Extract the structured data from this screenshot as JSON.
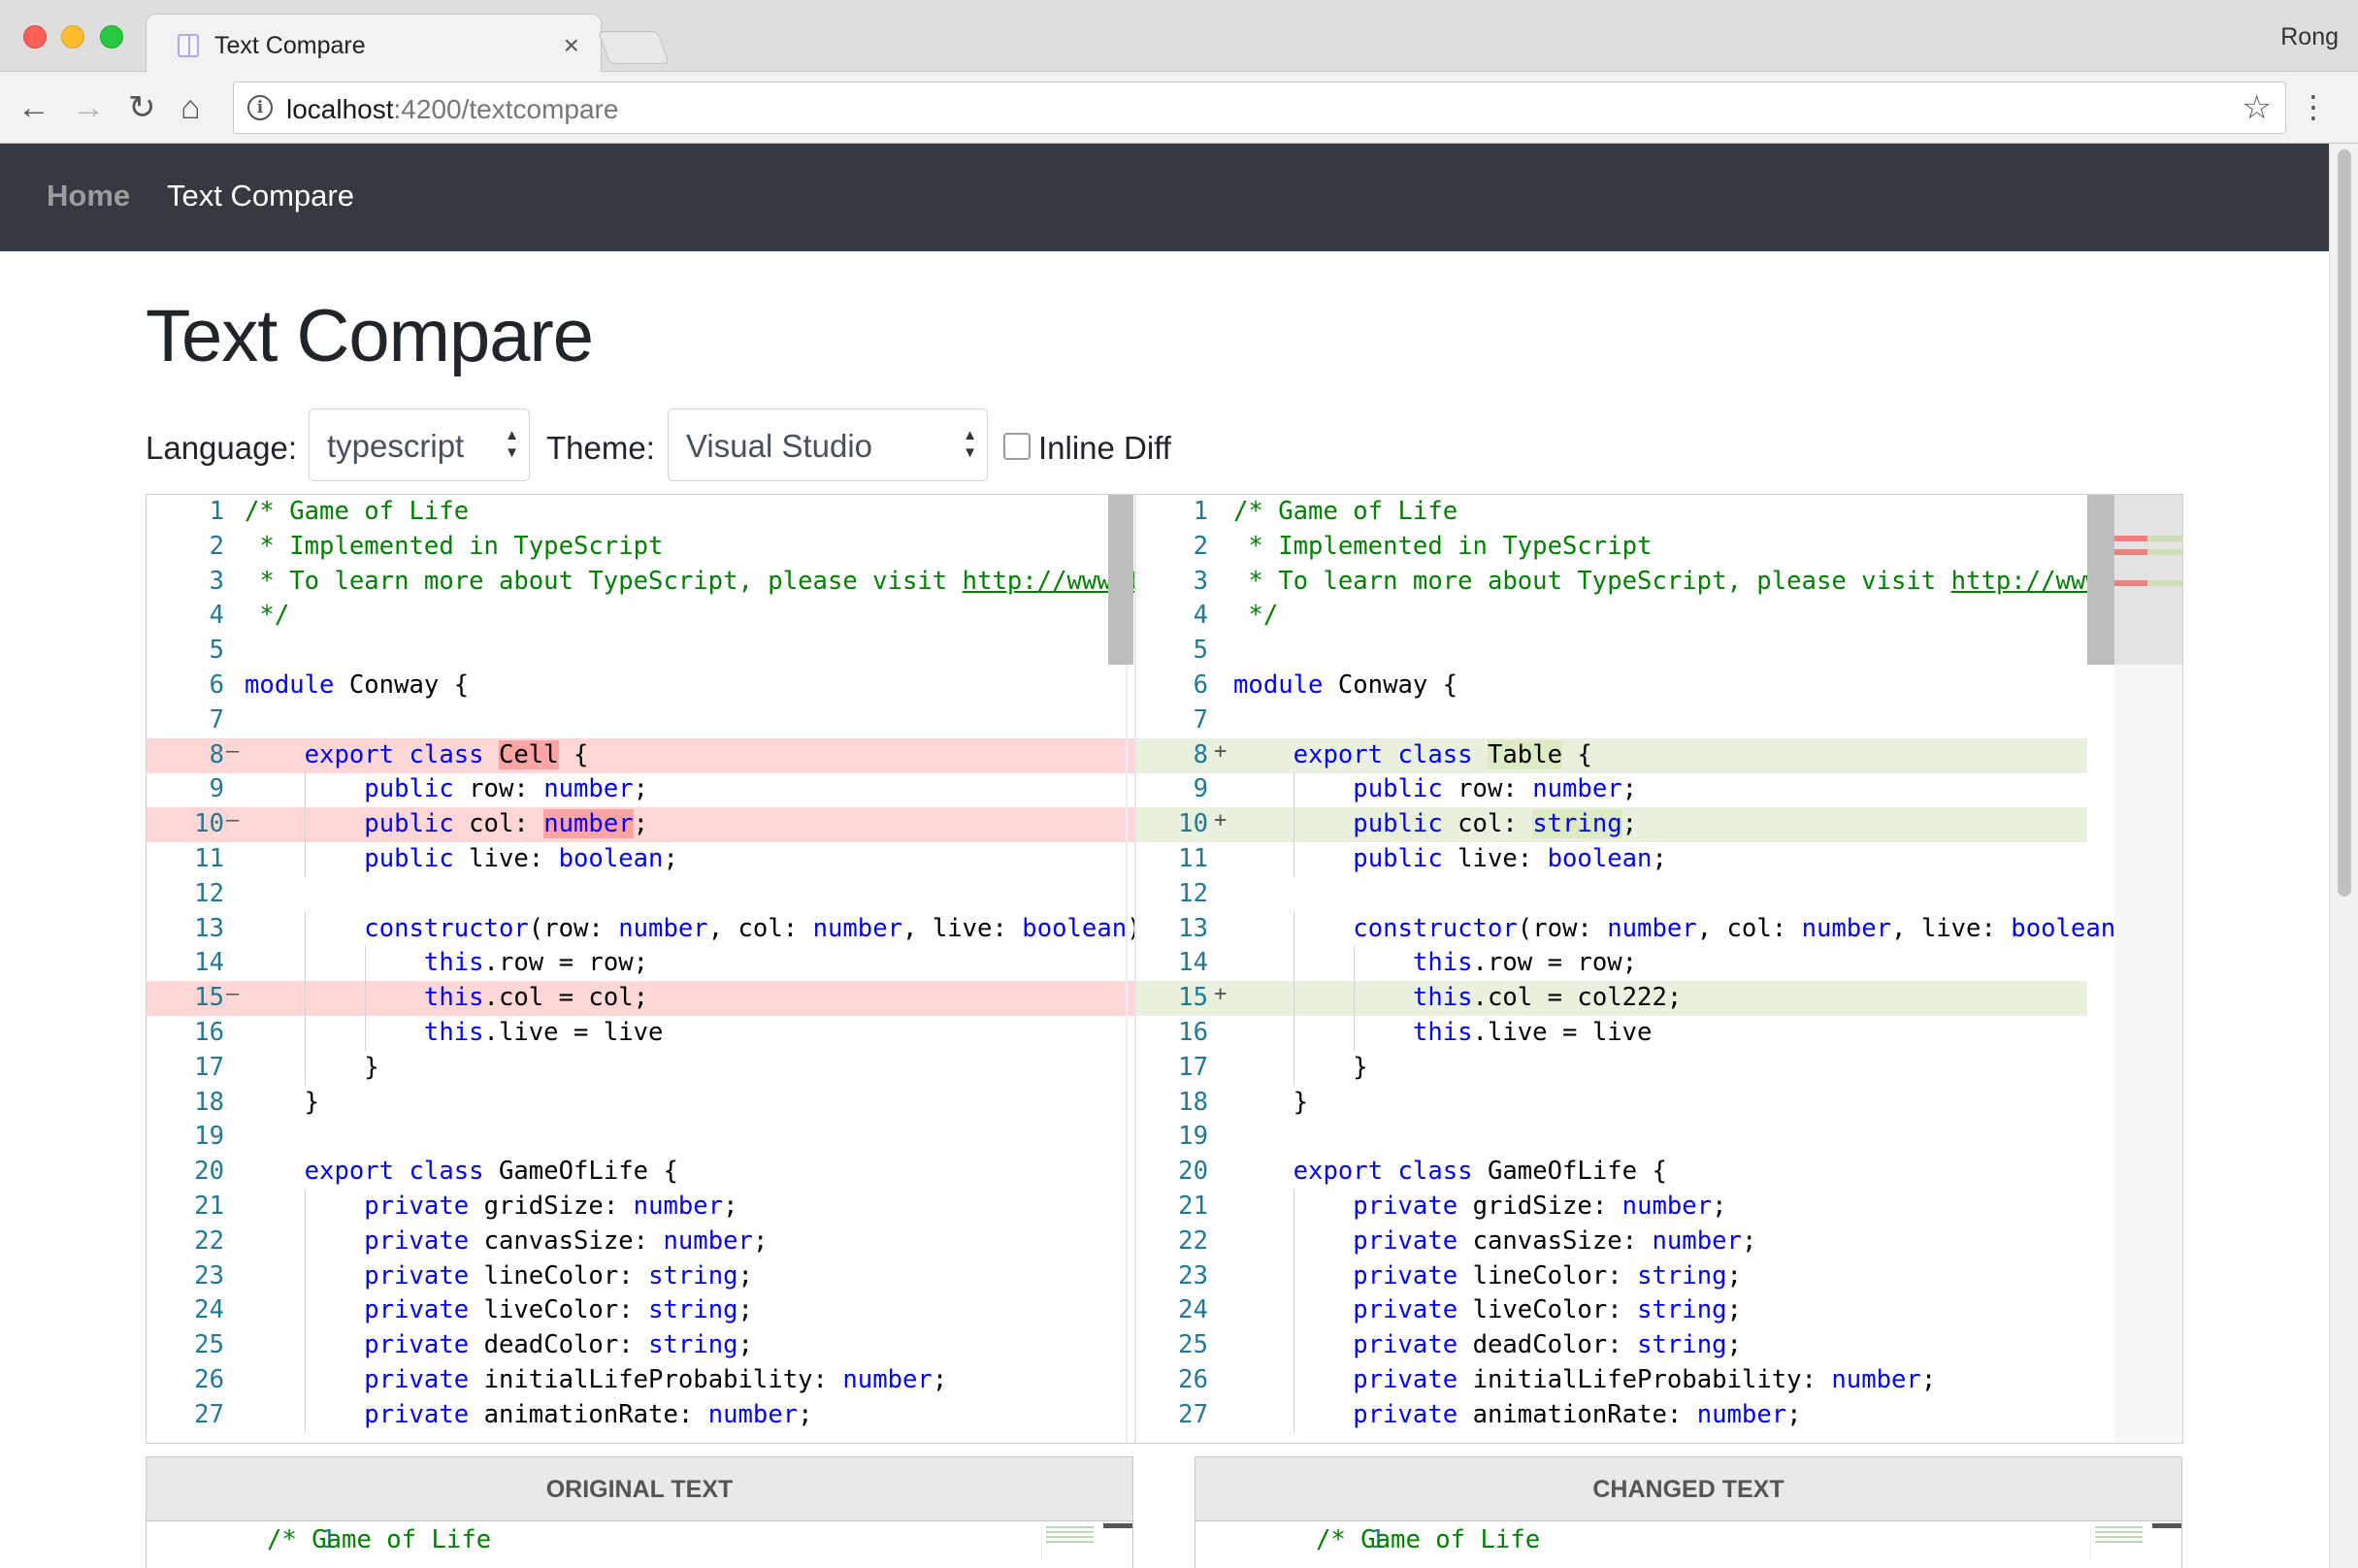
{
  "browser": {
    "tab_title": "Text Compare",
    "profile_name": "Rong",
    "url_host": "localhost",
    "url_rest": ":4200/textcompare"
  },
  "navbar": {
    "brand": "Home",
    "active": "Text Compare"
  },
  "page": {
    "title": "Text Compare",
    "language_label": "Language:",
    "language_value": "typescript",
    "theme_label": "Theme:",
    "theme_value": "Visual Studio",
    "inline_diff_label": "Inline Diff",
    "inline_diff_checked": false
  },
  "diff": {
    "original": [
      {
        "n": "1",
        "t": "",
        "code": [
          [
            "cm",
            "/* Game of Life"
          ]
        ]
      },
      {
        "n": "2",
        "t": "",
        "code": [
          [
            "cm",
            " * Implemented in TypeScript"
          ]
        ]
      },
      {
        "n": "3",
        "t": "",
        "code": [
          [
            "cm",
            " * To learn more about TypeScript, please visit "
          ],
          [
            "cm ul",
            "http://www.types"
          ]
        ]
      },
      {
        "n": "4",
        "t": "",
        "code": [
          [
            "cm",
            " */"
          ]
        ]
      },
      {
        "n": "5",
        "t": "",
        "code": []
      },
      {
        "n": "6",
        "t": "",
        "code": [
          [
            "kw",
            "module"
          ],
          [
            "",
            " Conway {"
          ]
        ]
      },
      {
        "n": "7",
        "t": "",
        "code": []
      },
      {
        "n": "8",
        "t": "del",
        "code": [
          [
            "",
            "    "
          ],
          [
            "kw",
            "export"
          ],
          [
            "",
            " "
          ],
          [
            "kw",
            "class"
          ],
          [
            "",
            " "
          ],
          [
            "hl-del",
            "Cell"
          ],
          [
            "",
            " {"
          ]
        ]
      },
      {
        "n": "9",
        "t": "",
        "code": [
          [
            "",
            "        "
          ],
          [
            "kw",
            "public"
          ],
          [
            "",
            " row: "
          ],
          [
            "kw",
            "number"
          ],
          [
            "",
            ";"
          ]
        ]
      },
      {
        "n": "10",
        "t": "del",
        "code": [
          [
            "",
            "        "
          ],
          [
            "kw",
            "public"
          ],
          [
            "",
            " col: "
          ],
          [
            "kw hl-del",
            "number"
          ],
          [
            "",
            ";"
          ]
        ]
      },
      {
        "n": "11",
        "t": "",
        "code": [
          [
            "",
            "        "
          ],
          [
            "kw",
            "public"
          ],
          [
            "",
            " live: "
          ],
          [
            "kw",
            "boolean"
          ],
          [
            "",
            ";"
          ]
        ]
      },
      {
        "n": "12",
        "t": "",
        "code": []
      },
      {
        "n": "13",
        "t": "",
        "code": [
          [
            "",
            "        "
          ],
          [
            "kw",
            "constructor"
          ],
          [
            "",
            "(row: "
          ],
          [
            "kw",
            "number"
          ],
          [
            "",
            ", col: "
          ],
          [
            "kw",
            "number"
          ],
          [
            "",
            ", live: "
          ],
          [
            "kw",
            "boolean"
          ],
          [
            "",
            ") {"
          ]
        ]
      },
      {
        "n": "14",
        "t": "",
        "code": [
          [
            "",
            "            "
          ],
          [
            "kw",
            "this"
          ],
          [
            "",
            ".row = row;"
          ]
        ]
      },
      {
        "n": "15",
        "t": "del",
        "code": [
          [
            "",
            "            "
          ],
          [
            "kw",
            "this"
          ],
          [
            "",
            ".col = col;"
          ]
        ]
      },
      {
        "n": "16",
        "t": "",
        "code": [
          [
            "",
            "            "
          ],
          [
            "kw",
            "this"
          ],
          [
            "",
            ".live = live"
          ]
        ]
      },
      {
        "n": "17",
        "t": "",
        "code": [
          [
            "",
            "        }"
          ]
        ]
      },
      {
        "n": "18",
        "t": "",
        "code": [
          [
            "",
            "    }"
          ]
        ]
      },
      {
        "n": "19",
        "t": "",
        "code": []
      },
      {
        "n": "20",
        "t": "",
        "code": [
          [
            "",
            "    "
          ],
          [
            "kw",
            "export"
          ],
          [
            "",
            " "
          ],
          [
            "kw",
            "class"
          ],
          [
            "",
            " GameOfLife {"
          ]
        ]
      },
      {
        "n": "21",
        "t": "",
        "code": [
          [
            "",
            "        "
          ],
          [
            "kw",
            "private"
          ],
          [
            "",
            " gridSize: "
          ],
          [
            "kw",
            "number"
          ],
          [
            "",
            ";"
          ]
        ]
      },
      {
        "n": "22",
        "t": "",
        "code": [
          [
            "",
            "        "
          ],
          [
            "kw",
            "private"
          ],
          [
            "",
            " canvasSize: "
          ],
          [
            "kw",
            "number"
          ],
          [
            "",
            ";"
          ]
        ]
      },
      {
        "n": "23",
        "t": "",
        "code": [
          [
            "",
            "        "
          ],
          [
            "kw",
            "private"
          ],
          [
            "",
            " lineColor: "
          ],
          [
            "kw",
            "string"
          ],
          [
            "",
            ";"
          ]
        ]
      },
      {
        "n": "24",
        "t": "",
        "code": [
          [
            "",
            "        "
          ],
          [
            "kw",
            "private"
          ],
          [
            "",
            " liveColor: "
          ],
          [
            "kw",
            "string"
          ],
          [
            "",
            ";"
          ]
        ]
      },
      {
        "n": "25",
        "t": "",
        "code": [
          [
            "",
            "        "
          ],
          [
            "kw",
            "private"
          ],
          [
            "",
            " deadColor: "
          ],
          [
            "kw",
            "string"
          ],
          [
            "",
            ";"
          ]
        ]
      },
      {
        "n": "26",
        "t": "",
        "code": [
          [
            "",
            "        "
          ],
          [
            "kw",
            "private"
          ],
          [
            "",
            " initialLifeProbability: "
          ],
          [
            "kw",
            "number"
          ],
          [
            "",
            ";"
          ]
        ]
      },
      {
        "n": "27",
        "t": "",
        "code": [
          [
            "",
            "        "
          ],
          [
            "kw",
            "private"
          ],
          [
            "",
            " animationRate: "
          ],
          [
            "kw",
            "number"
          ],
          [
            "",
            ";"
          ]
        ]
      }
    ],
    "modified": [
      {
        "n": "1",
        "t": "",
        "code": [
          [
            "cm",
            "/* Game of Life"
          ]
        ]
      },
      {
        "n": "2",
        "t": "",
        "code": [
          [
            "cm",
            " * Implemented in TypeScript"
          ]
        ]
      },
      {
        "n": "3",
        "t": "",
        "code": [
          [
            "cm",
            " * To learn more about TypeScript, please visit "
          ],
          [
            "cm ul",
            "http://www.types"
          ]
        ]
      },
      {
        "n": "4",
        "t": "",
        "code": [
          [
            "cm",
            " */"
          ]
        ]
      },
      {
        "n": "5",
        "t": "",
        "code": []
      },
      {
        "n": "6",
        "t": "",
        "code": [
          [
            "kw",
            "module"
          ],
          [
            "",
            " Conway {"
          ]
        ]
      },
      {
        "n": "7",
        "t": "",
        "code": []
      },
      {
        "n": "8",
        "t": "ins",
        "code": [
          [
            "",
            "    "
          ],
          [
            "kw",
            "export"
          ],
          [
            "",
            " "
          ],
          [
            "kw",
            "class"
          ],
          [
            "",
            " "
          ],
          [
            "hl-ins",
            "Table"
          ],
          [
            "",
            " {"
          ]
        ]
      },
      {
        "n": "9",
        "t": "",
        "code": [
          [
            "",
            "        "
          ],
          [
            "kw",
            "public"
          ],
          [
            "",
            " row: "
          ],
          [
            "kw",
            "number"
          ],
          [
            "",
            ";"
          ]
        ]
      },
      {
        "n": "10",
        "t": "ins",
        "code": [
          [
            "",
            "        "
          ],
          [
            "kw",
            "public"
          ],
          [
            "",
            " col: "
          ],
          [
            "kw hl-ins",
            "string"
          ],
          [
            "",
            ";"
          ]
        ]
      },
      {
        "n": "11",
        "t": "",
        "code": [
          [
            "",
            "        "
          ],
          [
            "kw",
            "public"
          ],
          [
            "",
            " live: "
          ],
          [
            "kw",
            "boolean"
          ],
          [
            "",
            ";"
          ]
        ]
      },
      {
        "n": "12",
        "t": "",
        "code": []
      },
      {
        "n": "13",
        "t": "",
        "code": [
          [
            "",
            "        "
          ],
          [
            "kw",
            "constructor"
          ],
          [
            "",
            "(row: "
          ],
          [
            "kw",
            "number"
          ],
          [
            "",
            ", col: "
          ],
          [
            "kw",
            "number"
          ],
          [
            "",
            ", live: "
          ],
          [
            "kw",
            "boolean"
          ],
          [
            "",
            ") {"
          ]
        ]
      },
      {
        "n": "14",
        "t": "",
        "code": [
          [
            "",
            "            "
          ],
          [
            "kw",
            "this"
          ],
          [
            "",
            ".row = row;"
          ]
        ]
      },
      {
        "n": "15",
        "t": "ins",
        "code": [
          [
            "",
            "            "
          ],
          [
            "kw",
            "this"
          ],
          [
            "",
            ".col = col222;"
          ]
        ]
      },
      {
        "n": "16",
        "t": "",
        "code": [
          [
            "",
            "            "
          ],
          [
            "kw",
            "this"
          ],
          [
            "",
            ".live = live"
          ]
        ]
      },
      {
        "n": "17",
        "t": "",
        "code": [
          [
            "",
            "        }"
          ]
        ]
      },
      {
        "n": "18",
        "t": "",
        "code": [
          [
            "",
            "    }"
          ]
        ]
      },
      {
        "n": "19",
        "t": "",
        "code": []
      },
      {
        "n": "20",
        "t": "",
        "code": [
          [
            "",
            "    "
          ],
          [
            "kw",
            "export"
          ],
          [
            "",
            " "
          ],
          [
            "kw",
            "class"
          ],
          [
            "",
            " GameOfLife {"
          ]
        ]
      },
      {
        "n": "21",
        "t": "",
        "code": [
          [
            "",
            "        "
          ],
          [
            "kw",
            "private"
          ],
          [
            "",
            " gridSize: "
          ],
          [
            "kw",
            "number"
          ],
          [
            "",
            ";"
          ]
        ]
      },
      {
        "n": "22",
        "t": "",
        "code": [
          [
            "",
            "        "
          ],
          [
            "kw",
            "private"
          ],
          [
            "",
            " canvasSize: "
          ],
          [
            "kw",
            "number"
          ],
          [
            "",
            ";"
          ]
        ]
      },
      {
        "n": "23",
        "t": "",
        "code": [
          [
            "",
            "        "
          ],
          [
            "kw",
            "private"
          ],
          [
            "",
            " lineColor: "
          ],
          [
            "kw",
            "string"
          ],
          [
            "",
            ";"
          ]
        ]
      },
      {
        "n": "24",
        "t": "",
        "code": [
          [
            "",
            "        "
          ],
          [
            "kw",
            "private"
          ],
          [
            "",
            " liveColor: "
          ],
          [
            "kw",
            "string"
          ],
          [
            "",
            ";"
          ]
        ]
      },
      {
        "n": "25",
        "t": "",
        "code": [
          [
            "",
            "        "
          ],
          [
            "kw",
            "private"
          ],
          [
            "",
            " deadColor: "
          ],
          [
            "kw",
            "string"
          ],
          [
            "",
            ";"
          ]
        ]
      },
      {
        "n": "26",
        "t": "",
        "code": [
          [
            "",
            "        "
          ],
          [
            "kw",
            "private"
          ],
          [
            "",
            " initialLifeProbability: "
          ],
          [
            "kw",
            "number"
          ],
          [
            "",
            ";"
          ]
        ]
      },
      {
        "n": "27",
        "t": "",
        "code": [
          [
            "",
            "        "
          ],
          [
            "kw",
            "private"
          ],
          [
            "",
            " animationRate: "
          ],
          [
            "kw",
            "number"
          ],
          [
            "",
            ";"
          ]
        ]
      }
    ]
  },
  "panels": {
    "original_title": "ORIGINAL TEXT",
    "changed_title": "CHANGED TEXT",
    "original_first_line_num": "1",
    "original_first_line": "/* Game of Life",
    "changed_first_line_num": "1",
    "changed_first_line": "/* Game of Life"
  },
  "colors": {
    "navbar": "#343a40",
    "deleted_line": "#ffd7d7",
    "inserted_line": "#e9f0de",
    "keyword": "#0000ff",
    "comment": "#008000",
    "line_number": "#237893"
  },
  "icons": {
    "back": "back-arrow-icon",
    "forward": "forward-arrow-icon",
    "reload": "reload-icon",
    "home": "home-icon",
    "info": "info-icon",
    "bookmark": "star-icon",
    "menu": "kebab-menu-icon",
    "favicon": "page-favicon-icon",
    "tab_close": "close-icon"
  }
}
